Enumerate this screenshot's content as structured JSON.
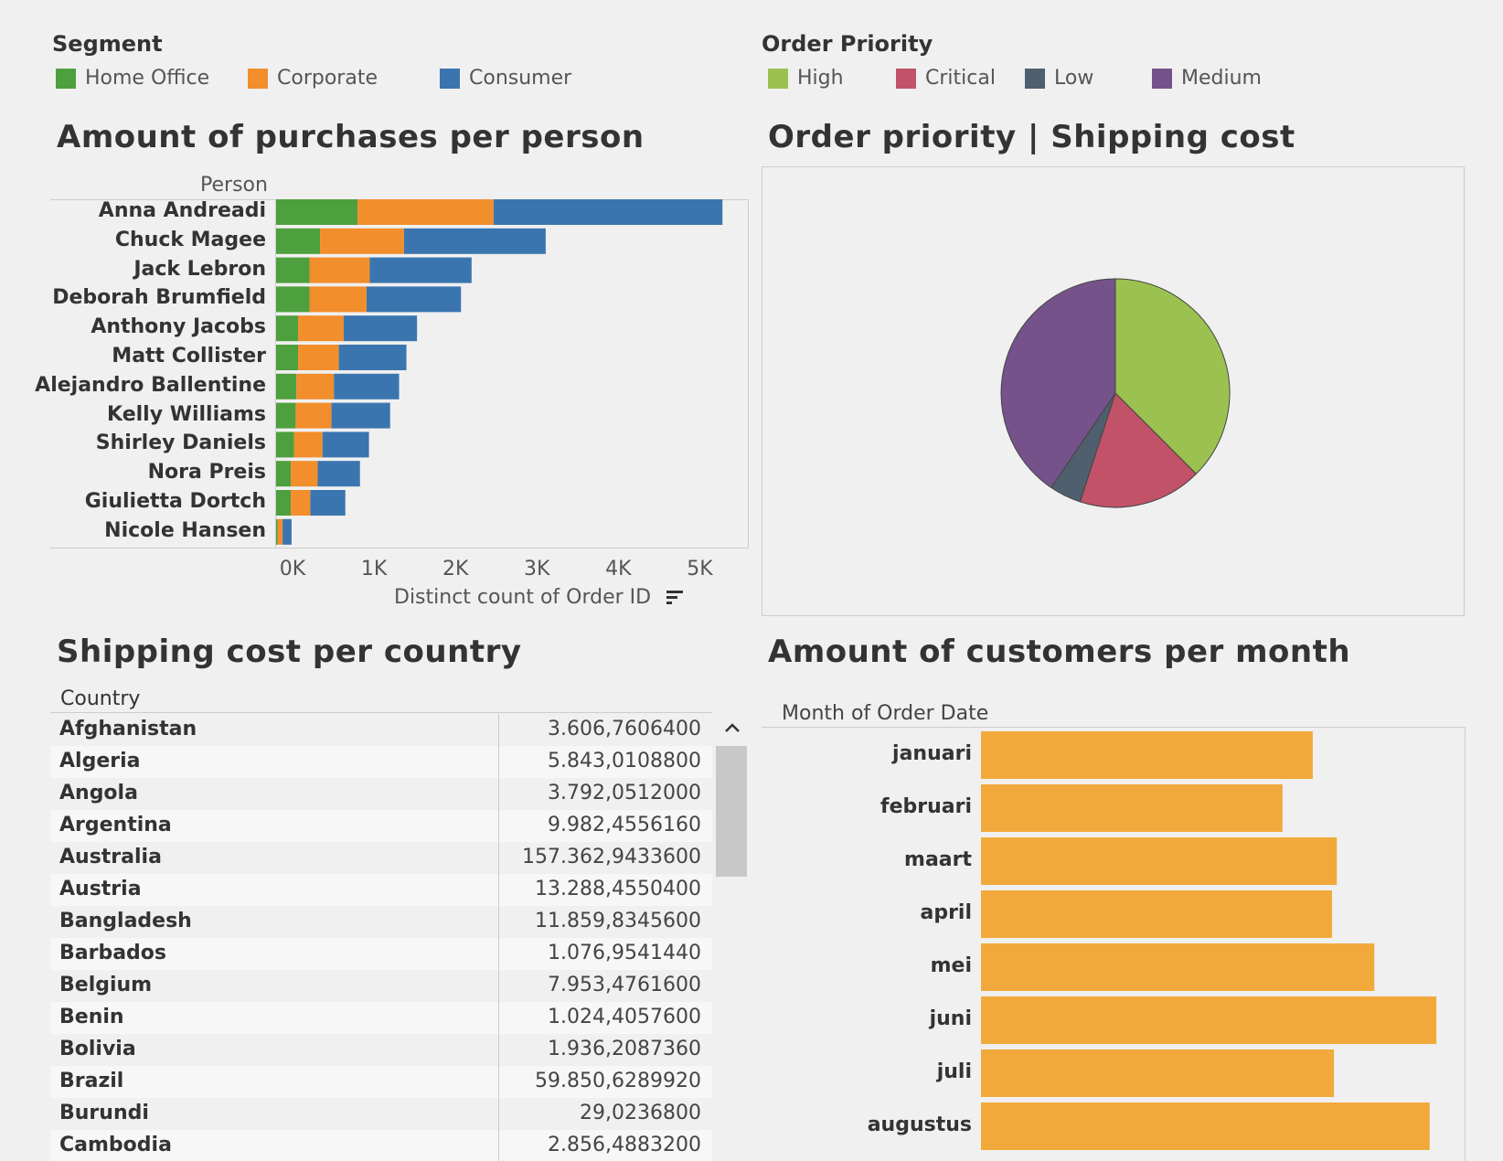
{
  "legends": {
    "segment": {
      "title": "Segment",
      "items": [
        {
          "label": "Home Office",
          "color": "#4e9f3d"
        },
        {
          "label": "Corporate",
          "color": "#f28e2b"
        },
        {
          "label": "Consumer",
          "color": "#3b75af"
        }
      ]
    },
    "priority": {
      "title": "Order Priority",
      "items": [
        {
          "label": "High",
          "color": "#9bc250"
        },
        {
          "label": "Critical",
          "color": "#c25268"
        },
        {
          "label": "Low",
          "color": "#4f5f6f"
        },
        {
          "label": "Medium",
          "color": "#76528b"
        }
      ]
    }
  },
  "charts": {
    "purchases": {
      "title": "Amount of purchases per person",
      "row_header": "Person"
    },
    "priority": {
      "title": "Order priority  |  Shipping cost"
    },
    "shipping": {
      "title": "Shipping cost per country",
      "column_header": "Country"
    },
    "customers": {
      "title": "Amount of customers per month",
      "row_header": "Month of Order Date"
    }
  },
  "chart_data": [
    {
      "type": "bar",
      "orientation": "horizontal",
      "stacked": true,
      "title": "Amount of purchases per person",
      "ylabel": "Person",
      "xlabel": "Distinct count of Order ID",
      "xlim": [
        0,
        5800
      ],
      "xticks": [
        "0K",
        "1K",
        "2K",
        "3K",
        "4K",
        "5K"
      ],
      "categories": [
        "Anna Andreadi",
        "Chuck Magee",
        "Jack Lebron",
        "Deborah Brumfield",
        "Anthony Jacobs",
        "Matt Collister",
        "Alejandro Ballentine",
        "Kelly Williams",
        "Shirley Daniels",
        "Nora Preis",
        "Giulietta Dortch",
        "Nicole Hansen"
      ],
      "series": [
        {
          "name": "Home Office",
          "color": "#4e9f3d",
          "values": [
            1000,
            540,
            410,
            410,
            270,
            270,
            250,
            240,
            220,
            180,
            180,
            20
          ]
        },
        {
          "name": "Corporate",
          "color": "#f28e2b",
          "values": [
            1670,
            1030,
            740,
            700,
            560,
            500,
            460,
            440,
            350,
            330,
            240,
            60
          ]
        },
        {
          "name": "Consumer",
          "color": "#3b75af",
          "values": [
            2810,
            1740,
            1250,
            1160,
            900,
            830,
            800,
            720,
            570,
            520,
            430,
            110
          ]
        }
      ]
    },
    {
      "type": "pie",
      "title": "Order priority  |  Shipping cost",
      "slices": [
        {
          "label": "High",
          "value": 37.5,
          "color": "#9bc250"
        },
        {
          "label": "Critical",
          "value": 17.5,
          "color": "#c25268"
        },
        {
          "label": "Low",
          "value": 4.5,
          "color": "#4f5f6f"
        },
        {
          "label": "Medium",
          "value": 40.5,
          "color": "#76528b"
        }
      ]
    },
    {
      "type": "table",
      "title": "Shipping cost per country",
      "columns": [
        "Country",
        ""
      ],
      "rows": [
        [
          "Afghanistan",
          "3.606,7606400"
        ],
        [
          "Algeria",
          "5.843,0108800"
        ],
        [
          "Angola",
          "3.792,0512000"
        ],
        [
          "Argentina",
          "9.982,4556160"
        ],
        [
          "Australia",
          "157.362,9433600"
        ],
        [
          "Austria",
          "13.288,4550400"
        ],
        [
          "Bangladesh",
          "11.859,8345600"
        ],
        [
          "Barbados",
          "1.076,9541440"
        ],
        [
          "Belgium",
          "7.953,4761600"
        ],
        [
          "Benin",
          "1.024,4057600"
        ],
        [
          "Bolivia",
          "1.936,2087360"
        ],
        [
          "Brazil",
          "59.850,6289920"
        ],
        [
          "Burundi",
          "29,0236800"
        ],
        [
          "Cambodia",
          "2.856,4883200"
        ]
      ]
    },
    {
      "type": "bar",
      "orientation": "horizontal",
      "title": "Amount of customers per month",
      "ylabel": "Month of Order Date",
      "color": "#f2a93b",
      "xlim": [
        0,
        1000
      ],
      "categories": [
        "januari",
        "februari",
        "maart",
        "april",
        "mei",
        "juni",
        "juli",
        "augustus"
      ],
      "values": [
        690,
        627,
        740,
        730,
        818,
        947,
        734,
        933
      ]
    }
  ]
}
